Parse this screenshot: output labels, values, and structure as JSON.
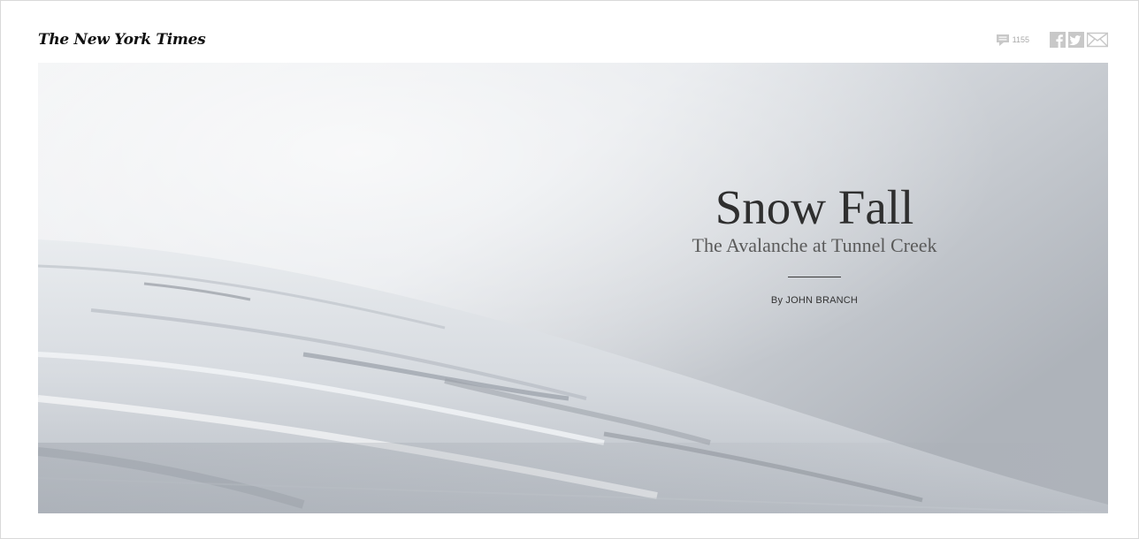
{
  "header": {
    "logo_text": "The New York Times",
    "comment_count": "1155",
    "share_icons": [
      "facebook-icon",
      "twitter-icon",
      "email-icon"
    ]
  },
  "article": {
    "title": "Snow Fall",
    "subtitle": "The Avalanche at Tunnel Creek",
    "byline": "By JOHN BRANCH"
  },
  "colors": {
    "icon_gray": "#c8c8c8",
    "title": "#2f2f2f",
    "sky_top": "#e9ebee",
    "sky_right": "#b3b8bf",
    "snow": "#dfe3e7"
  }
}
